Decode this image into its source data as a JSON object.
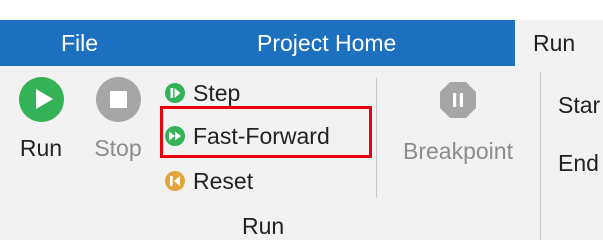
{
  "menu": {
    "file": "File",
    "project_home": "Project Home",
    "run_tab": "Run"
  },
  "ribbon": {
    "run_label": "Run",
    "stop_label": "Stop",
    "step_label": "Step",
    "fast_forward_label": "Fast-Forward",
    "reset_label": "Reset",
    "group_label": "Run",
    "breakpoint_label": "Breakpoint",
    "start_label_partial": "Star",
    "end_label_partial": "End"
  },
  "icons": {
    "run": "play-icon",
    "stop": "stop-icon",
    "step": "step-icon",
    "fast_forward": "fast-forward-icon",
    "reset": "reset-icon",
    "breakpoint": "breakpoint-icon"
  },
  "colors": {
    "menubar": "#1d6fc0",
    "ribbon": "#f2f2f2",
    "green": "#33b356",
    "orange": "#e3a53e",
    "disabled": "#a6a6a6",
    "highlight": "#e8000f"
  },
  "state": {
    "active_tab": "Run",
    "stop_enabled": false,
    "breakpoint_enabled": false,
    "highlighted_button": "Fast-Forward"
  }
}
